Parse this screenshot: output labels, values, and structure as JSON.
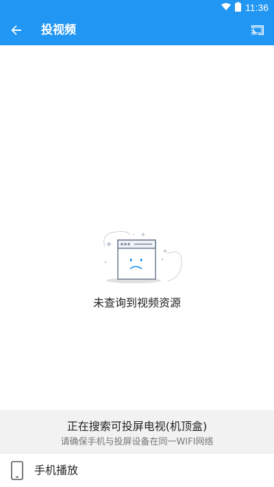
{
  "status_bar": {
    "time": "11:36",
    "wifi_icon": "wifi-icon",
    "battery_icon": "battery-icon"
  },
  "app_bar": {
    "title": "投视频",
    "back_icon": "back-arrow-icon",
    "cast_icon": "cast-icon",
    "color": "#2196f3"
  },
  "empty_state": {
    "message": "未查询到视频资源",
    "illustration": "sad-browser-illustration"
  },
  "cast_panel": {
    "searching_text": "正在搜索可投屏电视(机顶盒)",
    "hint_text": "请确保手机与投屏设备在同一WIFI网络"
  },
  "phone_play": {
    "label": "手机播放",
    "icon": "phone-icon"
  }
}
